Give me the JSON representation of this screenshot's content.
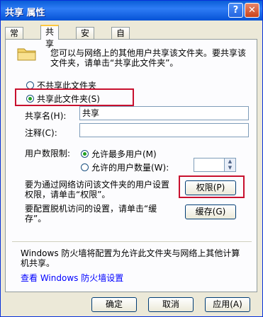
{
  "window": {
    "title": "共享 属性",
    "help_glyph": "?",
    "close_glyph": "✕"
  },
  "tabs": [
    "常规",
    "共享",
    "安全",
    "自定义"
  ],
  "intro": "您可以与网络上的其他用户共享该文件夹。要共享该文件夹，请单击“共享此文件夹”。",
  "radios": {
    "no_share": "不共享此文件夹",
    "share": "共享此文件夹(S)"
  },
  "share_name": {
    "label": "共享名(H):",
    "value": "共享"
  },
  "comment": {
    "label": "注释(C):",
    "value": ""
  },
  "user_limit": {
    "label": "用户数限制:",
    "max": "允许最多用户(M)",
    "allow": "允许的用户数量(W):"
  },
  "permissions": {
    "text": "要为通过网络访问该文件夹的用户设置权限，请单击“权限”。",
    "button": "权限(P)"
  },
  "caching": {
    "text": "要配置脱机访问的设置，请单击“缓存”。",
    "button": "缓存(G)"
  },
  "firewall": {
    "text": "Windows 防火墙将配置为允许此文件夹与网络上其他计算机共享。",
    "link": "查看 Windows 防火墙设置"
  },
  "footer": {
    "ok": "确定",
    "cancel": "取消",
    "apply": "应用(A)"
  },
  "colors": {
    "title_bar": "#0a5ed7",
    "highlight": "#c8102e",
    "link": "#0000ff"
  }
}
